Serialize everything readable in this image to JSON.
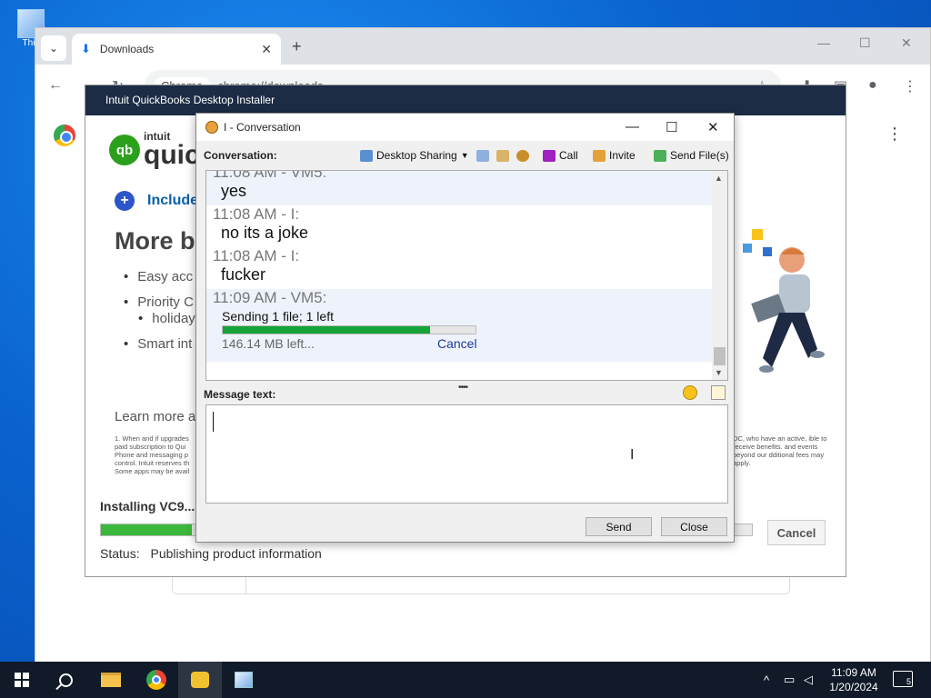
{
  "desktop": {
    "icon_label": "This"
  },
  "chrome": {
    "tab_title": "Downloads",
    "omnibox_chip": "Chrome",
    "omnibox_url": "chrome://downloads"
  },
  "installer": {
    "window_title": "Intuit QuickBooks Desktop Installer",
    "logo_small": "intuit",
    "logo_large": "quic",
    "include_text": "Include",
    "heading": "More b",
    "bullets": [
      "Easy acc",
      "Priority C",
      "holidays",
      "Smart int"
    ],
    "learn_more": "Learn more a",
    "fine_left": "1. When and if upgrades paid subscription to Qui Phone and messaging p control. Intuit reserves th Some apps may be avail",
    "fine_right": "DC, who have an active, ible to receive benefits. and events beyond our dditional fees may apply.",
    "installing_label": "Installing VC9...",
    "progress_fraction": 0.14,
    "cancel_label": "Cancel",
    "status_label": "Status:",
    "status_value": "Publishing product information"
  },
  "conversation": {
    "title": "I - Conversation",
    "toolbar_label": "Conversation:",
    "desktop_sharing": "Desktop Sharing",
    "call": "Call",
    "invite": "Invite",
    "send_files": "Send File(s)",
    "messages": [
      {
        "head": "11:08 AM - VM5:",
        "body": "yes"
      },
      {
        "head": "11:08 AM - I:",
        "body": "no its a joke"
      },
      {
        "head": "11:08 AM - I:",
        "body": "fucker"
      }
    ],
    "file_transfer": {
      "head": "11:09 AM - VM5:",
      "status": "Sending 1 file; 1 left",
      "progress_fraction": 0.82,
      "remaining": "146.14 MB left...",
      "cancel": "Cancel"
    },
    "message_text_label": "Message text:",
    "message_value": "",
    "send_label": "Send",
    "close_label": "Close"
  },
  "taskbar": {
    "time": "11:09 AM",
    "date": "1/20/2024",
    "notification_count": "5"
  }
}
